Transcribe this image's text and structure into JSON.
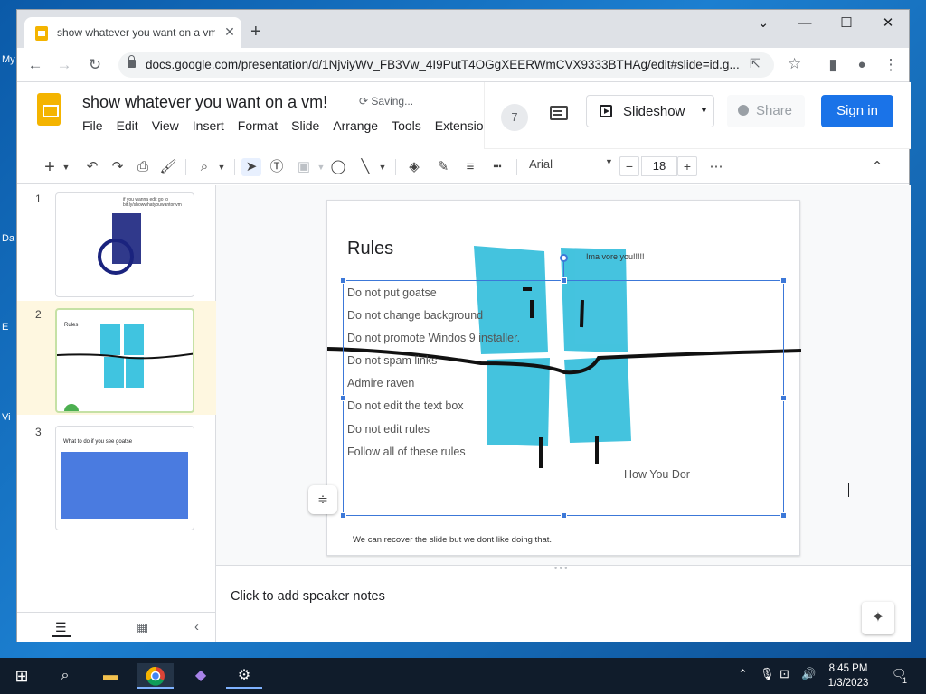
{
  "desktop": {
    "labels": [
      "My",
      "Da",
      "E",
      "Vi"
    ]
  },
  "browser": {
    "tab_title": "show whatever you want on a vm",
    "tab_close": "✕",
    "new_tab": "+",
    "win_minimize": "⌄",
    "win_restore": "☐",
    "win_close": "✕",
    "url": "docs.google.com/presentation/d/1NjviyWv_FB3Vw_4I9PutT4OGgXEERWmCVX9333BTHAg/edit#slide=id.g..."
  },
  "app": {
    "doc_title": "show whatever you want on a vm!",
    "saving_status": "Saving...",
    "menu": [
      "File",
      "Edit",
      "View",
      "Insert",
      "Format",
      "Slide",
      "Arrange",
      "Tools",
      "Extensio"
    ],
    "viewer_count": "7",
    "slideshow_label": "Slideshow",
    "share_label": "Share",
    "signin_label": "Sign in",
    "brand_color": "#f4b400",
    "accent_color": "#1a73e8"
  },
  "toolbar": {
    "font": "Arial",
    "font_size": "18"
  },
  "filmstrip": {
    "slides": [
      {
        "num": "1",
        "title": "if you wanna edit go to bit.ly/showwhatyouwantonvm"
      },
      {
        "num": "2",
        "title": "Rules"
      },
      {
        "num": "3",
        "title": "What to do if you see goatse"
      }
    ]
  },
  "slide": {
    "title": "Rules",
    "rules": [
      "Do not put goatse",
      "Do not change background",
      "Do not promote Windos 9 installer.",
      "Do not spam links",
      "Admire raven",
      "Do not edit the text box",
      "Do not edit rules",
      "Follow all of these rules"
    ],
    "typed_text": "How You Dor",
    "note_top": "Ima vore you!!!!!",
    "footnote": "We can recover the slide but we dont like doing that."
  },
  "notes": {
    "placeholder": "Click to add speaker notes"
  },
  "taskbar": {
    "time": "8:45 PM",
    "date": "1/3/2023",
    "notification_count": "1"
  }
}
